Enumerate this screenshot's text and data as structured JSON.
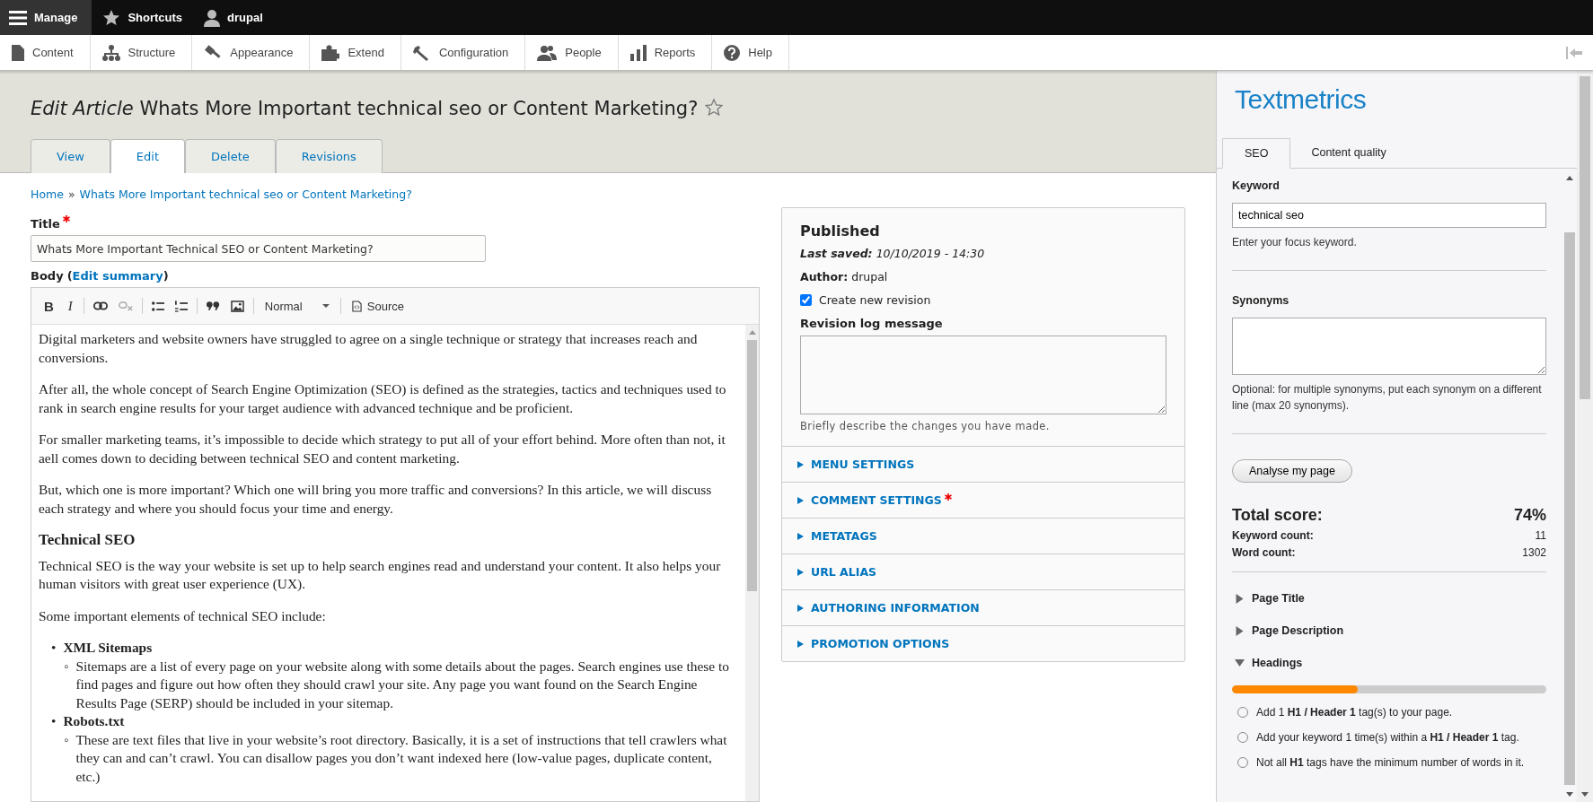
{
  "toolbar": {
    "manage": "Manage",
    "shortcuts": "Shortcuts",
    "user": "drupal"
  },
  "nav": [
    {
      "label": "Content"
    },
    {
      "label": "Structure"
    },
    {
      "label": "Appearance"
    },
    {
      "label": "Extend"
    },
    {
      "label": "Configuration"
    },
    {
      "label": "People"
    },
    {
      "label": "Reports"
    },
    {
      "label": "Help"
    }
  ],
  "page_title": {
    "prefix": "Edit Article",
    "title": "Whats More Important technical seo or Content Marketing?"
  },
  "tabs": [
    {
      "label": "View",
      "selected": false
    },
    {
      "label": "Edit",
      "selected": true
    },
    {
      "label": "Delete",
      "selected": false
    },
    {
      "label": "Revisions",
      "selected": false
    }
  ],
  "breadcrumb": [
    "Home",
    "»",
    "Whats More Important technical seo or Content Marketing?"
  ],
  "title_field": {
    "label": "Title",
    "required": true,
    "value": "Whats More Important Technical SEO or Content Marketing?"
  },
  "body_field": {
    "label": "Body",
    "open": "(",
    "link": "Edit summary",
    "close": ")"
  },
  "editor_toolbar": {
    "bold": "B",
    "italic": "I",
    "format": "Normal",
    "source": "Source"
  },
  "body_content": [
    {
      "kind": "p",
      "text": "Digital marketers and website owners have struggled to agree on a single technique or strategy that increases reach and conversions."
    },
    {
      "kind": "p",
      "text": "After all, the whole concept of Search Engine Optimization (SEO) is defined as the strategies, tactics and techniques used to rank in search engine results for your target audience with advanced technique and be proficient."
    },
    {
      "kind": "p",
      "text": "For smaller marketing teams, it’s impossible to decide which strategy to put all of your effort behind. More often than not, it aell comes down to deciding between technical SEO and content marketing."
    },
    {
      "kind": "p",
      "text": "But, which one is more important? Which one will bring you more traffic and conversions? In this article, we will discuss each strategy and where you should focus your time and energy."
    },
    {
      "kind": "heading",
      "text": "Technical SEO"
    },
    {
      "kind": "p",
      "text": "Technical SEO is the way your website is set up to help search engines read and understand your content. It also helps your human visitors with great user experience (UX)."
    },
    {
      "kind": "p",
      "text": "Some important elements of technical SEO include:"
    },
    {
      "kind": "list",
      "items": [
        {
          "marker": "•",
          "title": "XML Sitemaps",
          "child_marker": "◦",
          "children": [
            "Sitemaps are a list of every page on your website along with some details about the pages. Search engines use these to find pages and figure out how often they should crawl your site. Any page you want found on the Search Engine Results Page (SERP) should be included in your sitemap."
          ]
        },
        {
          "marker": "•",
          "title": "Robots.txt",
          "child_marker": "◦",
          "children": [
            "These are text files that live in your website’s root directory. Basically, it is a set of instructions that tell crawlers what they can and can’t crawl. You can disallow pages you don’t want indexed here (low-value pages, duplicate content, etc.)"
          ]
        }
      ]
    }
  ],
  "meta": {
    "status": "Published",
    "saved_label": "Last saved:",
    "saved_value": "10/10/2019 - 14:30",
    "author_label": "Author:",
    "author_value": "drupal",
    "revision_checkbox": {
      "label": "Create new revision",
      "checked": true
    },
    "log_label": "Revision log message",
    "log_hint": "Briefly describe the changes you have made.",
    "sections": [
      {
        "label": "MENU SETTINGS",
        "required": false
      },
      {
        "label": "COMMENT SETTINGS",
        "required": true
      },
      {
        "label": "METATAGS",
        "required": false
      },
      {
        "label": "URL ALIAS",
        "required": false
      },
      {
        "label": "AUTHORING INFORMATION",
        "required": false
      },
      {
        "label": "PROMOTION OPTIONS",
        "required": false
      }
    ]
  },
  "sidebar": {
    "logo": "Textmetrics",
    "tabs": [
      {
        "label": "SEO",
        "selected": true
      },
      {
        "label": "Content quality",
        "selected": false
      }
    ],
    "keyword": {
      "label": "Keyword",
      "value": "technical seo",
      "hint": "Enter your focus keyword."
    },
    "synonyms": {
      "label": "Synonyms",
      "hint": "Optional: for multiple synonyms, put each synonym on a different line (max 20 synonyms)."
    },
    "analyse_button": "Analyse my page",
    "total": {
      "label": "Total score:",
      "value": "74%"
    },
    "stats": [
      {
        "label": "Keyword count:",
        "value": "11"
      },
      {
        "label": "Word count:",
        "value": "1302"
      }
    ],
    "sections": [
      {
        "label": "Page Title",
        "expanded": false
      },
      {
        "label": "Page Description",
        "expanded": false
      },
      {
        "label": "Headings",
        "expanded": true,
        "level": 0.4,
        "checks": [
          "Add 1 **H1 / Header 1** tag(s) to your page.",
          "Add your keyword 1 time(s) within a **H1 / Header 1** tag.",
          "Not all **H1** tags have the minimum number of words in it."
        ]
      }
    ]
  }
}
